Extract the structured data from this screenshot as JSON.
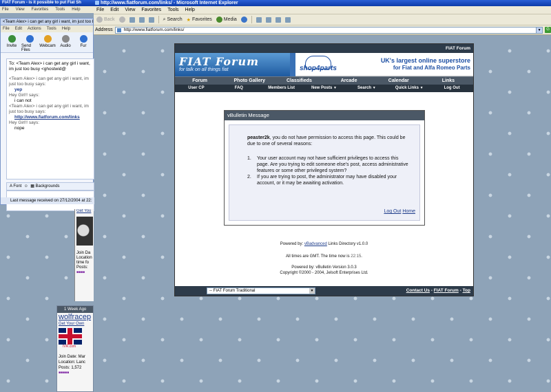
{
  "left_bg_window": {
    "title": "FIAT Forum - is it possible to put Fiat Sh",
    "menu": [
      "File",
      "View",
      "Favorites",
      "Tools",
      "Help"
    ]
  },
  "msn": {
    "title": "<Team Alex> i can get any girl i want, im just too busy",
    "menu": [
      "File",
      "Edit",
      "Actions",
      "Tools",
      "Help"
    ],
    "tools": [
      "Invite",
      "Send Files",
      "Webcam",
      "Audio",
      "Fur"
    ],
    "to_line": "To: <Team Alex> i can get any girl i want, im just too busy <ghostwid@",
    "lines": [
      {
        "cls": "q",
        "text": "<Team Alex> i can get any girl i want, im just too busy says:"
      },
      {
        "cls": "r yep",
        "text": "yep"
      },
      {
        "cls": "q",
        "text": "Hey Girl!! says:"
      },
      {
        "cls": "r",
        "text": "i can not"
      },
      {
        "cls": "q",
        "text": "<Team Alex> i can get any girl i want, im just too busy says:"
      },
      {
        "cls": "r url",
        "text": "http://www.fiatforum.com/links"
      },
      {
        "cls": "q",
        "text": "Hey Girl!! says:"
      },
      {
        "cls": "r",
        "text": "nope"
      }
    ],
    "font_label": "Font",
    "backgrounds_label": "Backgrounds",
    "status": "Last message received on 27/12/2004 at 22:"
  },
  "post_left_1": {
    "link": "Get You",
    "meta": [
      "Join Da",
      "Location",
      "time fo",
      "Posts:"
    ]
  },
  "post_left_2": {
    "header": "1 Week Ago",
    "name": "wolfracep",
    "get_your_own": "Get Your Own",
    "avatar_caption": "IVR.com",
    "join": "Join Date: Mar",
    "location": "Location: Lanc",
    "posts": "Posts: 1,572"
  },
  "browser": {
    "title": "http://www.fiatforum.com/links/ - Microsoft Internet Explorer",
    "menu": [
      "File",
      "Edit",
      "View",
      "Favorites",
      "Tools",
      "Help"
    ],
    "toolbar": {
      "back": "Back",
      "search": "Search",
      "favorites": "Favorites",
      "media": "Media"
    },
    "address_label": "Address",
    "address": "http://www.fiatforum.com/links/",
    "go_label": "G"
  },
  "forum": {
    "top_title": "FIAT Forum",
    "logo_main": "FIAT Forum",
    "logo_tagline": "for talk on all things fiat",
    "ad_shop": "shop",
    "ad_parts": "parts",
    "ad_line1": "UK's largest online superstore",
    "ad_line2": "for Fiat and Alfa Romeo Parts",
    "nav1": [
      "Forum",
      "Photo Gallery",
      "Classifieds",
      "Arcade",
      "Calendar",
      "Links"
    ],
    "nav2": [
      {
        "label": "User CP",
        "caret": ""
      },
      {
        "label": "FAQ",
        "caret": ""
      },
      {
        "label": "Members List",
        "caret": ""
      },
      {
        "label": "New Posts",
        "caret": "▼"
      },
      {
        "label": "Search",
        "caret": "▼"
      },
      {
        "label": "Quick Links",
        "caret": "▼"
      },
      {
        "label": "Log Out",
        "caret": ""
      }
    ],
    "message": {
      "header": "vBulletin Message",
      "user": "peaster2k",
      "intro": ", you do not have permission to access this page. This could be due to one of several reasons:",
      "reasons": [
        {
          "n": "1.",
          "t": "Your user account may not have sufficient privileges to access this page. Are you trying to edit someone else's post, access administrative features or some other privileged system?"
        },
        {
          "n": "2.",
          "t": "If you are trying to post, the administrator may have disabled your account, or it may be awaiting activation."
        }
      ],
      "logout": "Log Out",
      "home": "Home"
    },
    "powered1_prefix": "Powered by: ",
    "powered1_link": "vBadvanced",
    "powered1_suffix": " Links Directory v1.0.0",
    "time_prefix": "All times are GMT. The time now is ",
    "time_value": "22:15",
    "powered2": "Powered by: vBulletin Version 3.0.3",
    "copyright": "Copyright ©2000 - 2004, Jelsoft Enterprises Ltd.",
    "style_select": "-- FIAT Forum Traditional",
    "footer_links": [
      "Contact Us",
      "FIAT Forum",
      "Top"
    ]
  }
}
